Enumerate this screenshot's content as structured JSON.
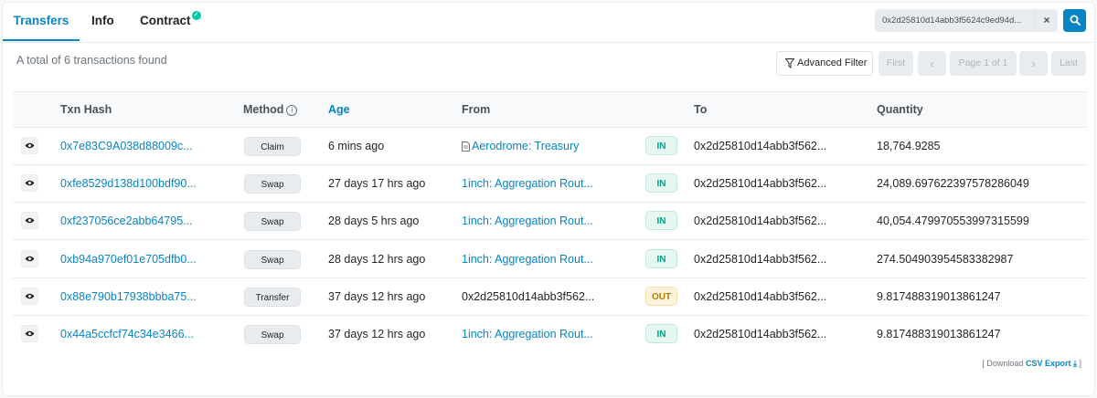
{
  "tabs": [
    {
      "label": "Transfers",
      "active": true
    },
    {
      "label": "Info",
      "active": false
    },
    {
      "label": "Contract",
      "active": false,
      "verified": true
    }
  ],
  "search": {
    "value": "0x2d25810d14abb3f5624c9ed94d...",
    "clear_symbol": "×",
    "icon": "search-icon"
  },
  "toolbar": {
    "total_text": "A total of 6 transactions found",
    "advanced_filter_label": "Advanced Filter"
  },
  "pagination": {
    "first": "First",
    "prev": "‹",
    "page": "Page 1 of 1",
    "next": "›",
    "last": "Last"
  },
  "table": {
    "headers": {
      "txn_hash": "Txn Hash",
      "method": "Method",
      "age": "Age",
      "from": "From",
      "to": "To",
      "quantity": "Quantity"
    },
    "rows": [
      {
        "hash": "0x7e83C9A038d88009c...",
        "method": "Claim",
        "age": "6 mins ago",
        "from": "Aerodrome: Treasury",
        "from_is_link": true,
        "from_has_doc_icon": true,
        "direction": "IN",
        "to": "0x2d25810d14abb3f562...",
        "quantity": "18,764.9285"
      },
      {
        "hash": "0xfe8529d138d100bdf90...",
        "method": "Swap",
        "age": "27 days 17 hrs ago",
        "from": "1inch: Aggregation Rout...",
        "from_is_link": true,
        "direction": "IN",
        "to": "0x2d25810d14abb3f562...",
        "quantity": "24,089.697622397578286049"
      },
      {
        "hash": "0xf237056ce2abb64795...",
        "method": "Swap",
        "age": "28 days 5 hrs ago",
        "from": "1inch: Aggregation Rout...",
        "from_is_link": true,
        "direction": "IN",
        "to": "0x2d25810d14abb3f562...",
        "quantity": "40,054.479970553997315599"
      },
      {
        "hash": "0xb94a970ef01e705dfb0...",
        "method": "Swap",
        "age": "28 days 12 hrs ago",
        "from": "1inch: Aggregation Rout...",
        "from_is_link": true,
        "direction": "IN",
        "to": "0x2d25810d14abb3f562...",
        "quantity": "274.504903954583382987"
      },
      {
        "hash": "0x88e790b17938bbba75...",
        "method": "Transfer",
        "age": "37 days 12 hrs ago",
        "from": "0x2d25810d14abb3f562...",
        "from_is_link": false,
        "direction": "OUT",
        "to": "0x2d25810d14abb3f562...",
        "quantity": "9.817488319013861247"
      },
      {
        "hash": "0x44a5ccfcf74c34e3466...",
        "method": "Swap",
        "age": "37 days 12 hrs ago",
        "from": "1inch: Aggregation Rout...",
        "from_is_link": true,
        "direction": "IN",
        "to": "0x2d25810d14abb3f562...",
        "quantity": "9.817488319013861247"
      }
    ]
  },
  "footer": {
    "prefix": "[ Download",
    "link": "CSV Export",
    "suffix": "]"
  },
  "colors": {
    "accent": "#0784c3",
    "in_badge": "#00a186",
    "out_badge": "#b47d00",
    "verified": "#00c9a7"
  }
}
